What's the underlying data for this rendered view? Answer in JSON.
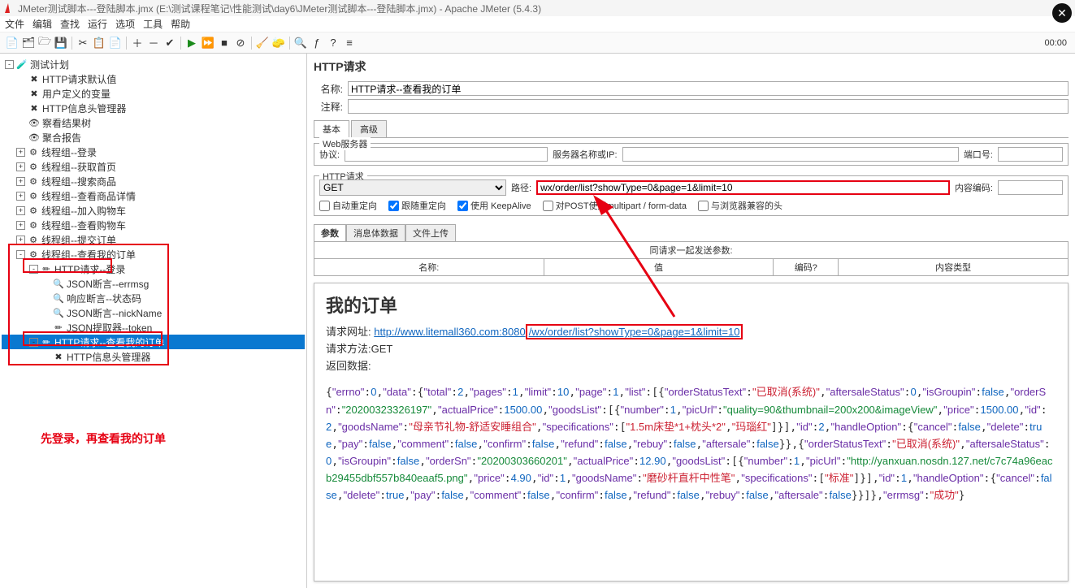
{
  "window": {
    "title": "JMeter测试脚本---登陆脚本.jmx (E:\\测试课程笔记\\性能测试\\day6\\JMeter测试脚本---登陆脚本.jmx) - Apache JMeter (5.4.3)"
  },
  "menus": [
    "文件",
    "编辑",
    "查找",
    "运行",
    "选项",
    "工具",
    "帮助"
  ],
  "timer": "00:00",
  "tree": {
    "root": "测试计划",
    "items": [
      "HTTP请求默认值",
      "用户定义的变量",
      "HTTP信息头管理器",
      "察看结果树",
      "聚合报告",
      "线程组--登录",
      "线程组--获取首页",
      "线程组--搜索商品",
      "线程组--查看商品详情",
      "线程组--加入购物车",
      "线程组--查看购物车",
      "线程组--提交订单",
      "线程组--查看我的订单"
    ],
    "sub": {
      "login": "HTTP请求--登录",
      "assert1": "JSON断言--errmsg",
      "assert2": "响应断言--状态码",
      "assert3": "JSON断言--nickName",
      "extract": "JSON提取器--token",
      "selected": "HTTP请求--查看我的订单",
      "header": "HTTP信息头管理器"
    }
  },
  "note": "先登录，再查看我的订单",
  "panel": {
    "title": "HTTP请求",
    "name_label": "名称:",
    "name_value": "HTTP请求--查看我的订单",
    "comment_label": "注释:",
    "comment_value": "",
    "tabs": {
      "basic": "基本",
      "adv": "高级"
    },
    "ws": {
      "legend": "Web服务器",
      "proto": "协议:",
      "host": "服务器名称或IP:",
      "port": "端口号:"
    },
    "req": {
      "legend": "HTTP请求",
      "method": "GET",
      "path_label": "路径:",
      "path": "wx/order/list?showType=0&page=1&limit=10",
      "enc": "内容编码:"
    },
    "chk": {
      "a": "自动重定向",
      "b": "跟随重定向",
      "c": "使用 KeepAlive",
      "d": "对POST使用multipart / form-data",
      "e": "与浏览器兼容的头"
    },
    "ptabs": {
      "p": "参数",
      "b": "消息体数据",
      "f": "文件上传"
    },
    "grid": {
      "title": "同请求一起发送参数:",
      "c1": "名称:",
      "c2": "值",
      "c3": "编码?",
      "c4": "内容类型"
    }
  },
  "doc": {
    "h": "我的订单",
    "url_label": "请求网址:",
    "url_pre": "http://www.litemall360.com:8080",
    "url_hi": "/wx/order/list?showType=0&page=1&limit=10",
    "method_label": "请求方法:",
    "method": "GET",
    "ret_label": "返回数据:"
  },
  "chart_data": {
    "type": "table",
    "title": "返回数据 JSON",
    "json": {
      "errno": 0,
      "data": {
        "total": 2,
        "pages": 1,
        "limit": 10,
        "page": 1,
        "list": [
          {
            "orderStatusText": "已取消(系统)",
            "aftersaleStatus": 0,
            "isGroupin": false,
            "orderSn": "20200323326197",
            "actualPrice": 1500.0,
            "goodsList": [
              {
                "number": 1,
                "picUrl": "quality=90&thumbnail=200x200&imageView",
                "price": 1500.0,
                "id": 2,
                "goodsName": "母亲节礼物-舒适安睡组合",
                "specifications": [
                  "1.5m床垫*1+枕头*2",
                  "玛瑙红"
                ]
              }
            ],
            "id": 2,
            "handleOption": {
              "cancel": false,
              "delete": true,
              "pay": false,
              "comment": false,
              "confirm": false,
              "refund": false,
              "rebuy": false,
              "aftersale": false
            }
          },
          {
            "orderStatusText": "已取消(系统)",
            "aftersaleStatus": 0,
            "isGroupin": false,
            "orderSn": "20200303660201",
            "actualPrice": 12.9,
            "goodsList": [
              {
                "number": 1,
                "picUrl": "http://yanxuan.nosdn.127.net/c7c74a96eacb29455dbf557b840eaaf5.png",
                "price": 4.9,
                "id": 1,
                "goodsName": "磨砂杆直杆中性笔",
                "specifications": [
                  "标准"
                ]
              }
            ],
            "id": 1,
            "handleOption": {
              "cancel": false,
              "delete": true,
              "pay": false,
              "comment": false,
              "confirm": false,
              "refund": false,
              "rebuy": false,
              "aftersale": false
            }
          }
        ]
      },
      "errmsg": "成功"
    }
  }
}
